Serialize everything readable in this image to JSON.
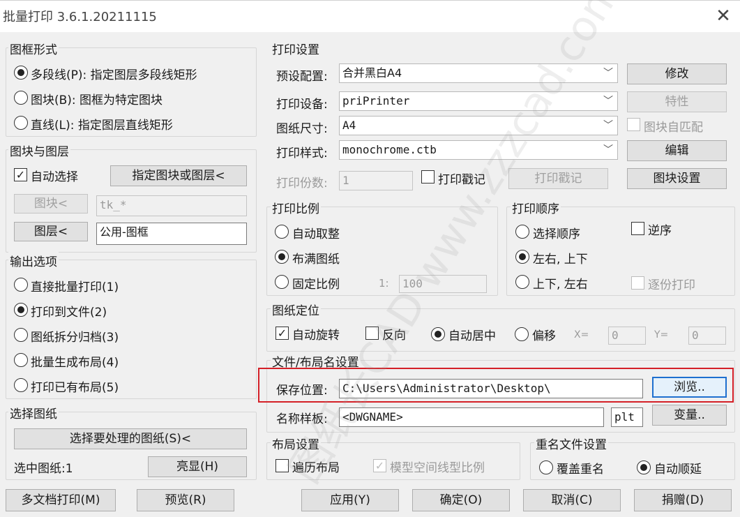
{
  "window": {
    "title": "批量打印 3.6.1.20211115",
    "close_glyph": "✕"
  },
  "frame_style": {
    "title": "图框形式",
    "options": [
      {
        "label": "多段线(P): 指定图层多段线矩形",
        "selected": true
      },
      {
        "label": "图块(B): 图框为特定图块",
        "selected": false
      },
      {
        "label": "直线(L): 指定图层直线矩形",
        "selected": false
      }
    ]
  },
  "block_layer": {
    "title": "图块与图层",
    "auto_select_label": "自动选择",
    "auto_select_checked": true,
    "specify_button": "指定图块或图层<",
    "block_button": "图块<",
    "block_value": "tk_*",
    "layer_button": "图层<",
    "layer_value": "公用-图框"
  },
  "output": {
    "title": "输出选项",
    "options": [
      {
        "label": "直接批量打印(1)",
        "selected": false
      },
      {
        "label": "打印到文件(2)",
        "selected": true
      },
      {
        "label": "图纸拆分归档(3)",
        "selected": false
      },
      {
        "label": "批量生成布局(4)",
        "selected": false
      },
      {
        "label": "打印已有布局(5)",
        "selected": false
      }
    ]
  },
  "select_drawing": {
    "title": "选择图纸",
    "select_button": "选择要处理的图纸(S)<",
    "selected_count_label": "选中图纸:1",
    "highlight_button": "亮显(H)"
  },
  "print_settings": {
    "title": "打印设置",
    "preset_label": "预设配置:",
    "preset_value": "合并黑白A4",
    "modify_button": "修改",
    "device_label": "打印设备:",
    "device_value": "priPrinter",
    "properties_button": "特性",
    "paper_label": "图纸尺寸:",
    "paper_value": "A4",
    "auto_match_label": "图块自匹配",
    "style_label": "打印样式:",
    "style_value": "monochrome.ctb",
    "edit_button": "编辑",
    "copies_label": "打印份数:",
    "copies_value": "1",
    "stamp_label": "打印戳记",
    "stamp_button": "打印戳记",
    "block_settings_button": "图块设置"
  },
  "print_scale": {
    "title": "打印比例",
    "options": [
      {
        "label": "自动取整",
        "selected": false
      },
      {
        "label": "布满图纸",
        "selected": true
      },
      {
        "label": "固定比例",
        "selected": false
      }
    ],
    "ratio_prefix": "1:",
    "ratio_value": "100"
  },
  "print_order": {
    "title": "打印顺序",
    "options": [
      {
        "label": "选择顺序",
        "selected": false
      },
      {
        "label": "左右, 上下",
        "selected": true
      },
      {
        "label": "上下, 左右",
        "selected": false
      }
    ],
    "reverse_label": "逆序",
    "collate_label": "逐份打印"
  },
  "positioning": {
    "title": "图纸定位",
    "auto_rotate_label": "自动旋转",
    "reverse_label": "反向",
    "center_label": "自动居中",
    "offset_label": "偏移",
    "x_label": "X=",
    "x_value": "0",
    "y_label": "Y=",
    "y_value": "0"
  },
  "file_naming": {
    "title": "文件/布局名设置",
    "save_label": "保存位置:",
    "save_value": "C:\\Users\\Administrator\\Desktop\\",
    "browse_button": "浏览..",
    "template_label": "名称样板:",
    "template_value": "<DWGNAME>",
    "ext_value": "plt",
    "variable_button": "变量.."
  },
  "layout_settings": {
    "title": "布局设置",
    "traverse_label": "遍历布局",
    "linetype_label": "模型空间线型比例"
  },
  "rename": {
    "title": "重名文件设置",
    "overwrite_label": "覆盖重名",
    "auto_inc_label": "自动顺延"
  },
  "footer": {
    "multi_doc_button": "多文档打印(M)",
    "preview_button": "预览(R)",
    "apply_button": "应用(Y)",
    "ok_button": "确定(O)",
    "cancel_button": "取消(C)",
    "donate_button": "捐赠(D)"
  },
  "watermark": "图纸长CAD www.zzzcad.com"
}
